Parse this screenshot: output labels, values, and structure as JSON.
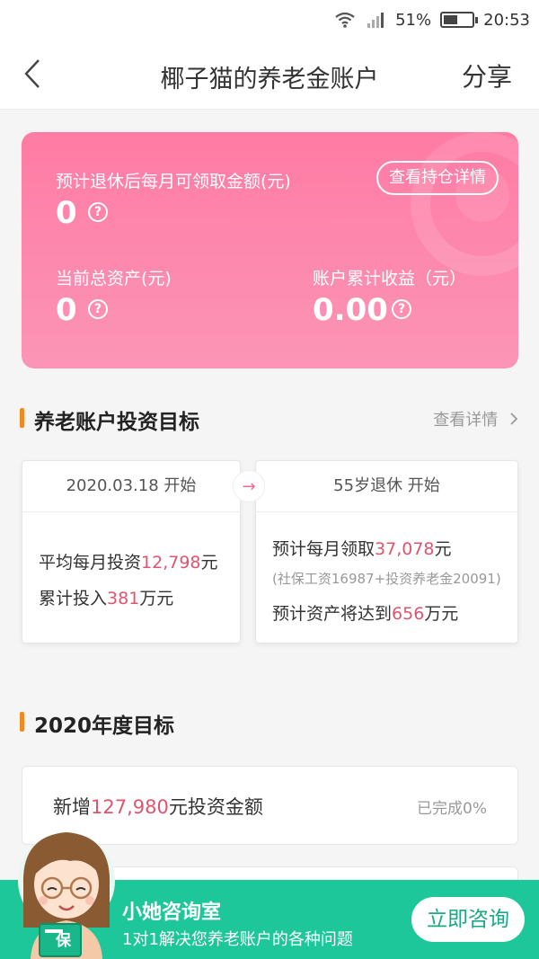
{
  "status_bar": {
    "battery": "51%",
    "time": "20:53",
    "battery_level": 0.51
  },
  "nav": {
    "title": "椰子猫的养老金账户",
    "share": "分享"
  },
  "asset_card": {
    "monthly_label": "预计退休后每月可领取金额(元)",
    "monthly_value": "0",
    "holdings_button": "查看持仓详情",
    "total_label": "当前总资产(元)",
    "total_value": "0",
    "earnings_label": "账户累计收益（元）",
    "earnings_value": "0.00",
    "help_glyph": "?"
  },
  "goal_section": {
    "title": "养老账户投资目标",
    "link": "查看详情",
    "left": {
      "head": "2020.03.18 开始",
      "line1_pre": "平均每月投资",
      "line1_val": "12,798",
      "line1_post": "元",
      "line2_pre": "累计投入",
      "line2_val": "381",
      "line2_post": "万元"
    },
    "right": {
      "head": "55岁退休 开始",
      "line1_pre": "预计每月领取",
      "line1_val": "37,078",
      "line1_post": "元",
      "line2": "(社保工资16987+投资养老金20091)",
      "line3_pre": "预计资产将达到",
      "line3_val": "656",
      "line3_post": "万元"
    }
  },
  "annual_section": {
    "title": "2020年度目标",
    "item_pre": "新增",
    "item_val": "127,980",
    "item_post": "元投资金额",
    "item_status": "已完成0%"
  },
  "consult": {
    "title": "小她咨询室",
    "subtitle": "1对1解决您养老账户的各种问题",
    "button": "立即咨询",
    "avatar_badge": "保"
  },
  "colors": {
    "card_pink": "#ff7ba4",
    "accent_orange": "#f08a24",
    "highlight": "#e0556e",
    "banner_green": "#1ec799"
  }
}
